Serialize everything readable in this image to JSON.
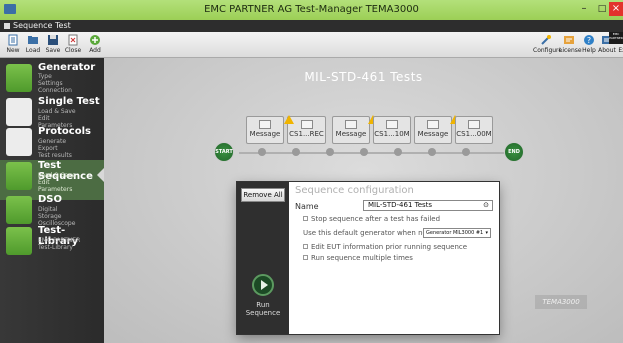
{
  "window": {
    "title": "EMC PARTNER AG   Test-Manager TEMA3000",
    "controls": [
      "–",
      "□",
      "×"
    ]
  },
  "document_tab": {
    "label": "Sequence Test"
  },
  "toolbar": {
    "left": [
      {
        "label": "New",
        "icon": "new-document-icon"
      },
      {
        "label": "Load",
        "icon": "folder-open-icon"
      },
      {
        "label": "Save",
        "icon": "floppy-disk-icon"
      },
      {
        "label": "Close",
        "icon": "close-document-icon"
      },
      {
        "label": "Add",
        "icon": "add-icon"
      }
    ],
    "right": [
      {
        "label": "Configure",
        "icon": "tools-icon"
      },
      {
        "label": "License",
        "icon": "license-icon"
      },
      {
        "label": "Help",
        "icon": "help-icon"
      },
      {
        "label": "About",
        "icon": "about-icon"
      },
      {
        "label": "Ex",
        "icon": "exit-icon"
      }
    ],
    "logo_text": "EMC PARTNER"
  },
  "sidebar": {
    "items": [
      {
        "title": "Generator",
        "subs": [
          "Type",
          "Settings",
          "Connection"
        ],
        "active": false
      },
      {
        "title": "Single Test",
        "subs": [
          "Load & Save",
          "Edit",
          "Parameters"
        ],
        "active": false
      },
      {
        "title": "Protocols",
        "subs": [
          "Generate",
          "Export",
          "Test results"
        ],
        "active": false
      },
      {
        "title": "Test Sequence",
        "subs": [
          "Load & Save",
          "Edit",
          "Parameters"
        ],
        "active": true
      },
      {
        "title": "DSO",
        "subs": [
          "Digital",
          "Storage",
          "Oscilloscope"
        ],
        "active": false
      },
      {
        "title": "Test-Library",
        "subs": [
          "EMC PARTNER",
          "Test-Library"
        ],
        "active": false
      }
    ]
  },
  "sequence": {
    "title": "MIL-STD-461 Tests",
    "start_label": "START",
    "end_label": "END",
    "steps": [
      {
        "label": "Message",
        "warning": false
      },
      {
        "label": "CS1...REC",
        "warning": true
      },
      {
        "label": "Message",
        "warning": false
      },
      {
        "label": "CS1...10M",
        "warning": true
      },
      {
        "label": "Message",
        "warning": false
      },
      {
        "label": "CS1...00M",
        "warning": true
      }
    ]
  },
  "dialog": {
    "remove_all_label": "Remove All",
    "run_label": "Run Sequence",
    "title": "Sequence configuration",
    "name_label": "Name",
    "name_value": "MIL-STD-461 Tests",
    "option_stop": "Stop sequence after a test has failed",
    "option_generator": "Use this default generator when none",
    "generator_value": "Generator MIL3000 #1",
    "option_edit_eut": "Edit EUT information prior running sequence",
    "option_run_multiple": "Run sequence multiple times"
  },
  "watermark": "TEMA3000",
  "colors": {
    "titlebar": "#9ccf56",
    "sidebar": "#2b2b2b",
    "active_item": "#4c6c43",
    "accent_green": "#3a9141",
    "warning": "#f0b400",
    "close_button": "#e2332c"
  }
}
